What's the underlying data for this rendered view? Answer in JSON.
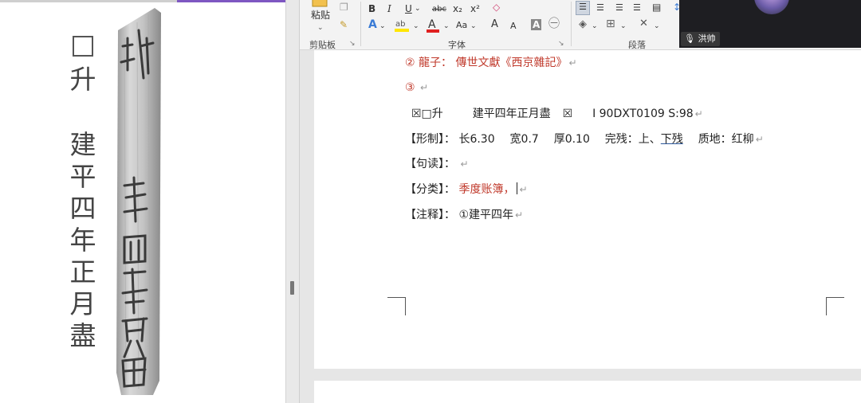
{
  "left_viewer": {
    "transcription": {
      "line1": [
        "□",
        "升"
      ],
      "line2": [
        "建",
        "平",
        "四",
        "年",
        "正",
        "月",
        "盡"
      ]
    },
    "slip_image": "wooden slip photograph"
  },
  "ribbon": {
    "paste_label": "粘贴",
    "clipboard_group": "剪贴板",
    "font_group": "字体",
    "paragraph_group": "段落",
    "format_buttons": [
      "B",
      "I",
      "U",
      "abc",
      "x₂",
      "x²"
    ],
    "font_size_buttons": [
      "Aa",
      "A",
      "A"
    ],
    "colors": {
      "highlight": "#ffe600",
      "font_color": "#e02020",
      "text_effect": "#3a7bd5"
    }
  },
  "webcam": {
    "name": "洪帅"
  },
  "document": {
    "line1": {
      "num": "②",
      "label": "龍子：",
      "text": "傳世文獻《西京雜記》"
    },
    "line2": {
      "num": "③"
    },
    "line3": {
      "pre": "☒□升",
      "title": "建平四年正月盡",
      "sym": "☒",
      "ref": "Ⅰ 90DXT0109 S:98"
    },
    "line4": {
      "label": "【形制】：",
      "a": "长6.30",
      "b": "宽0.7",
      "c": "厚0.10",
      "d": "完残：上、",
      "d2": "下残",
      "e": "质地：红柳"
    },
    "line5": {
      "label": "【句读】："
    },
    "line6": {
      "label": "【分类】：",
      "value": "季度账簿，"
    },
    "line7": {
      "label": "【注释】：",
      "value": "①建平四年"
    },
    "para_mark": "↵"
  }
}
